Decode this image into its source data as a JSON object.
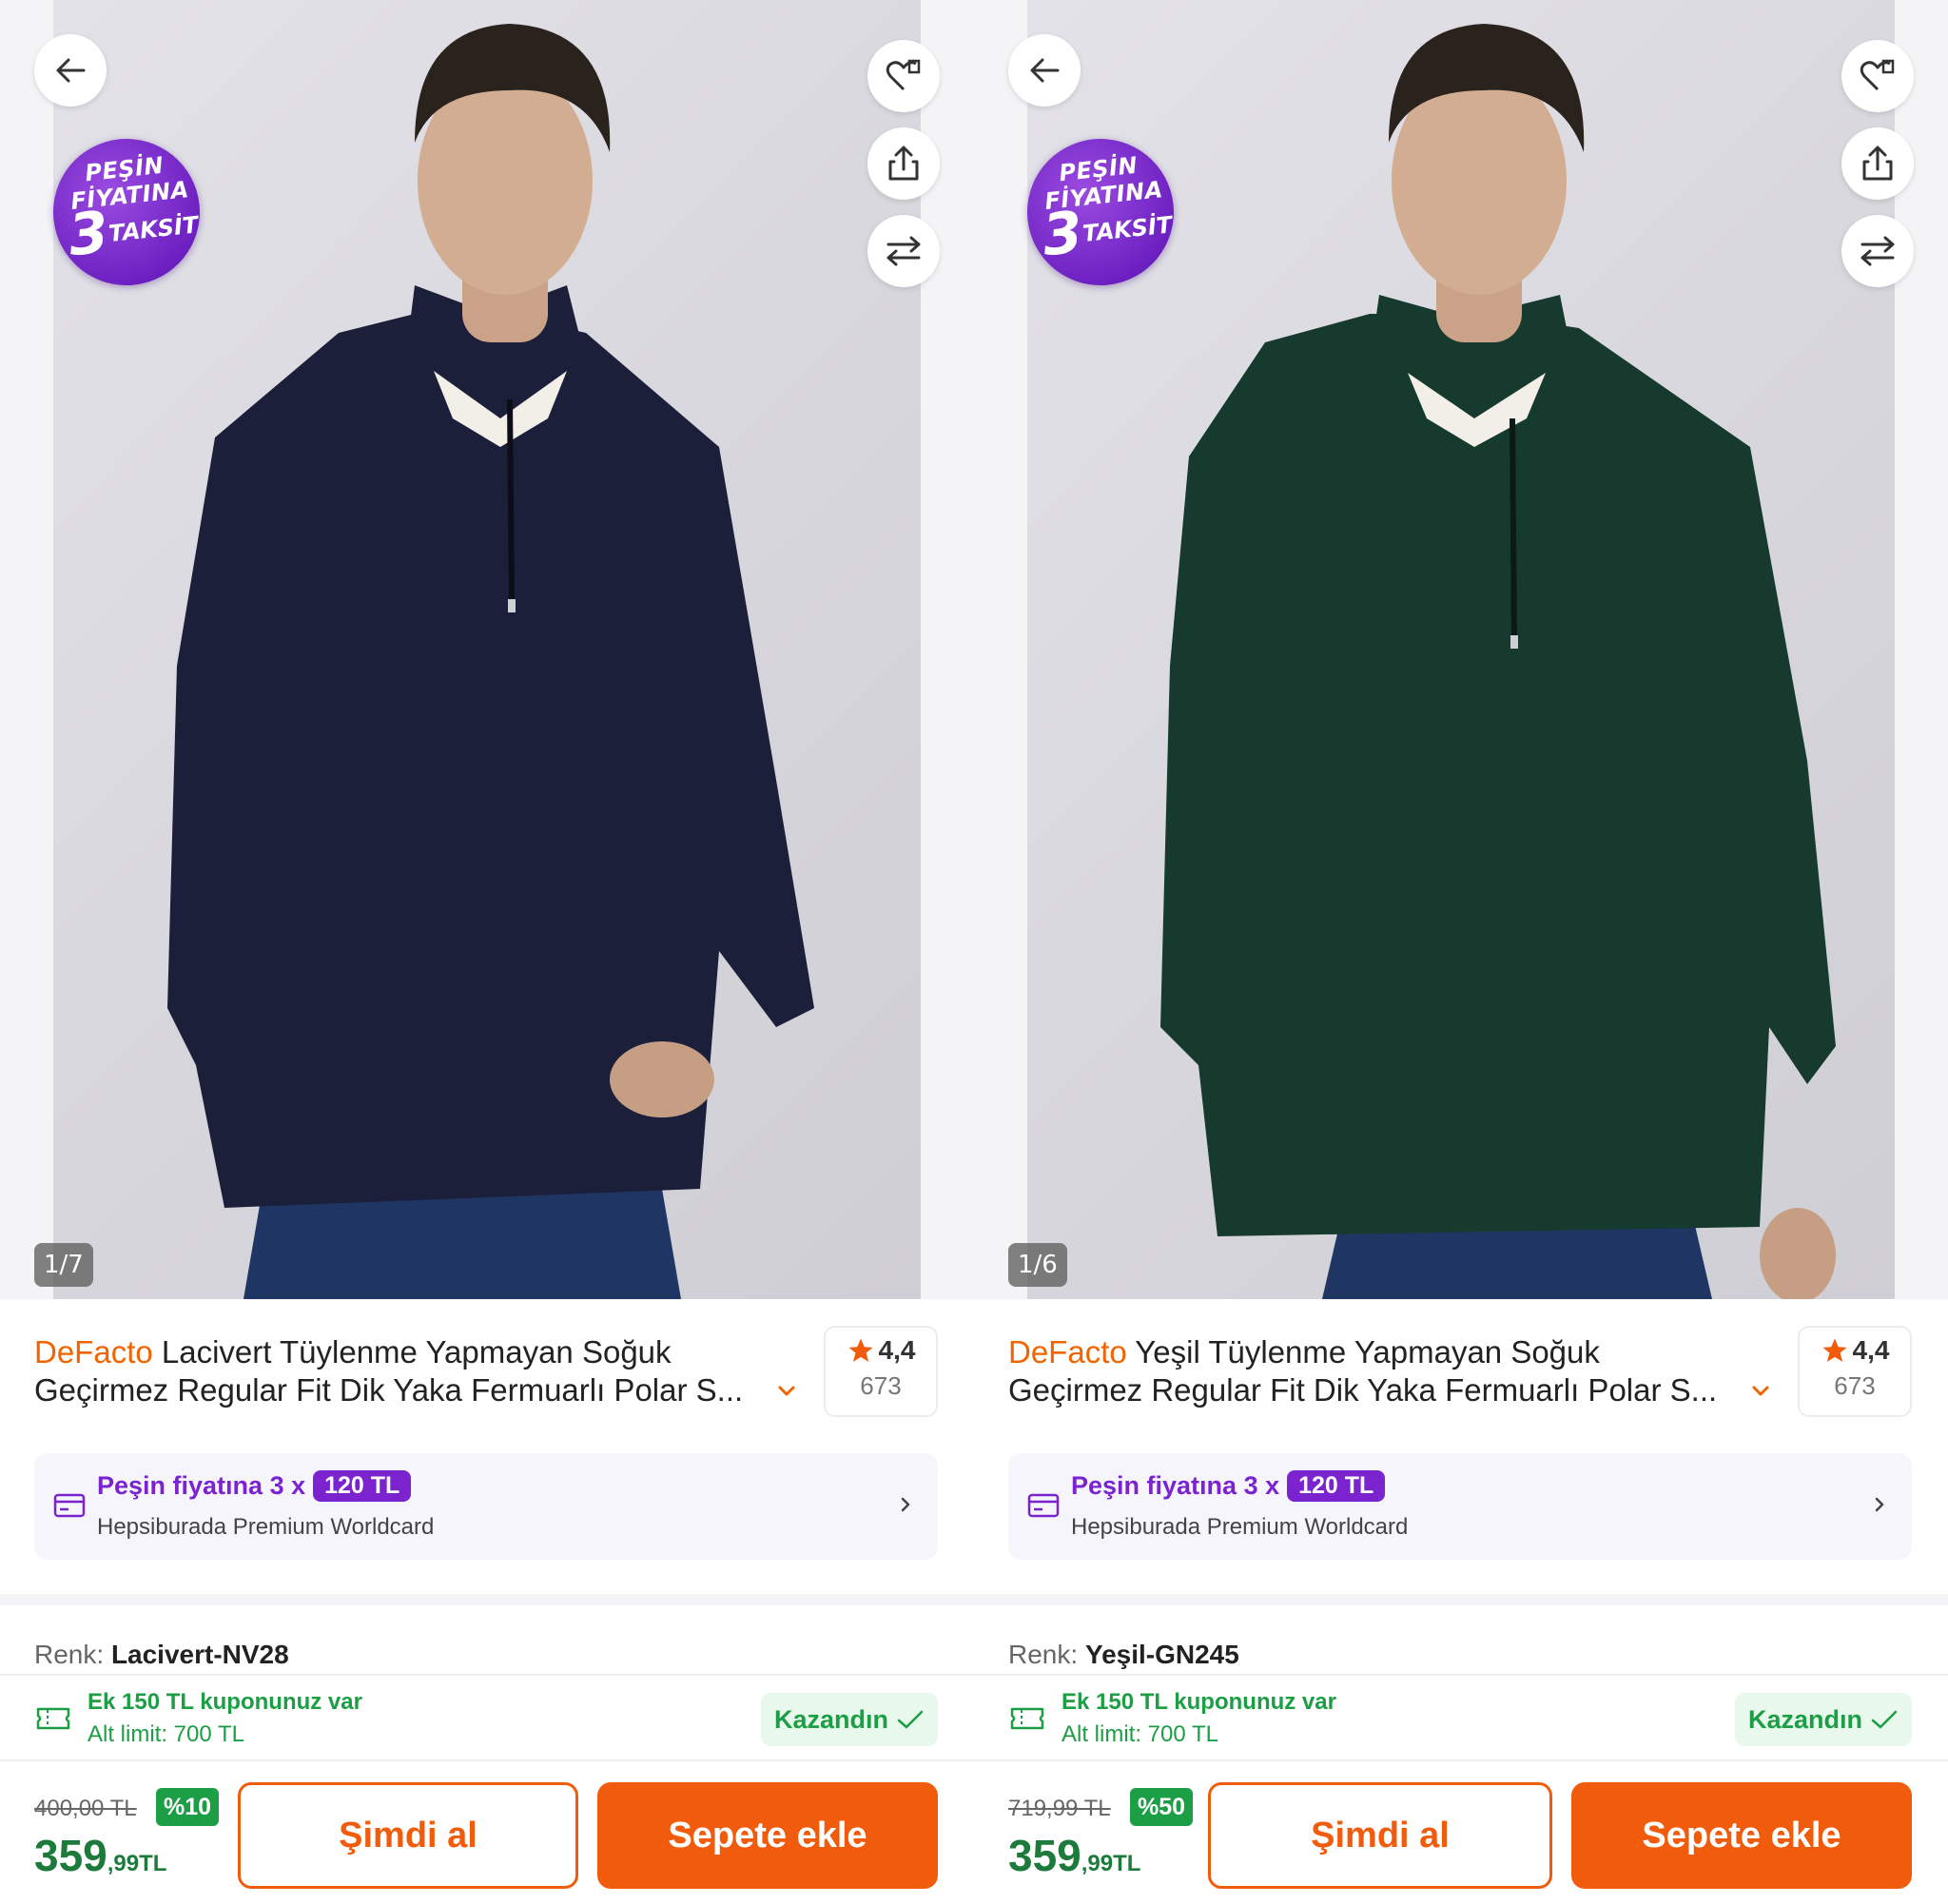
{
  "panels": [
    {
      "image_counter": "1/7",
      "badge": {
        "line1": "PEŞİN",
        "line2": "FİYATINA",
        "number": "3",
        "line3": "TAKSİT"
      },
      "brand": "DeFacto",
      "title_rest": "Lacivert Tüylenme Yapmayan Soğuk",
      "title_line2": "Geçirmez Regular Fit Dik Yaka Fermuarlı Polar S...",
      "rating": "4,4",
      "rating_count": "673",
      "installment": {
        "prefix": "Peşin fiyatına 3 x",
        "amount": "120 TL",
        "card": "Hepsiburada Premium Worldcard"
      },
      "color_label": "Renk:",
      "color_value": "Lacivert-NV28",
      "coupon": {
        "line1": "Ek 150 TL kuponunuz var",
        "line2": "Alt limit: 700 TL",
        "status": "Kazandın"
      },
      "old_price": "400,00 TL",
      "discount": "%10",
      "price_int": "359",
      "price_dec": ",99TL",
      "buy_now": "Şimdi al",
      "add_to_cart": "Sepete ekle",
      "garment_color": "#1c1f3a"
    },
    {
      "image_counter": "1/6",
      "badge": {
        "line1": "PEŞİN",
        "line2": "FİYATINA",
        "number": "3",
        "line3": "TAKSİT"
      },
      "brand": "DeFacto",
      "title_rest": "Yeşil Tüylenme Yapmayan Soğuk",
      "title_line2": "Geçirmez Regular Fit Dik Yaka Fermuarlı Polar S...",
      "rating": "4,4",
      "rating_count": "673",
      "installment": {
        "prefix": "Peşin fiyatına 3 x",
        "amount": "120 TL",
        "card": "Hepsiburada Premium Worldcard"
      },
      "color_label": "Renk:",
      "color_value": "Yeşil-GN245",
      "coupon": {
        "line1": "Ek 150 TL kuponunuz var",
        "line2": "Alt limit: 700 TL",
        "status": "Kazandın"
      },
      "old_price": "719,99 TL",
      "discount": "%50",
      "price_int": "359",
      "price_dec": ",99TL",
      "buy_now": "Şimdi al",
      "add_to_cart": "Sepete ekle",
      "garment_color": "#163a2e"
    }
  ],
  "colors": {
    "brand_orange": "#f16400",
    "cta_orange": "#f15c0c",
    "purple": "#7a23cf",
    "green": "#1c9e44",
    "star": "#f15c0c"
  }
}
